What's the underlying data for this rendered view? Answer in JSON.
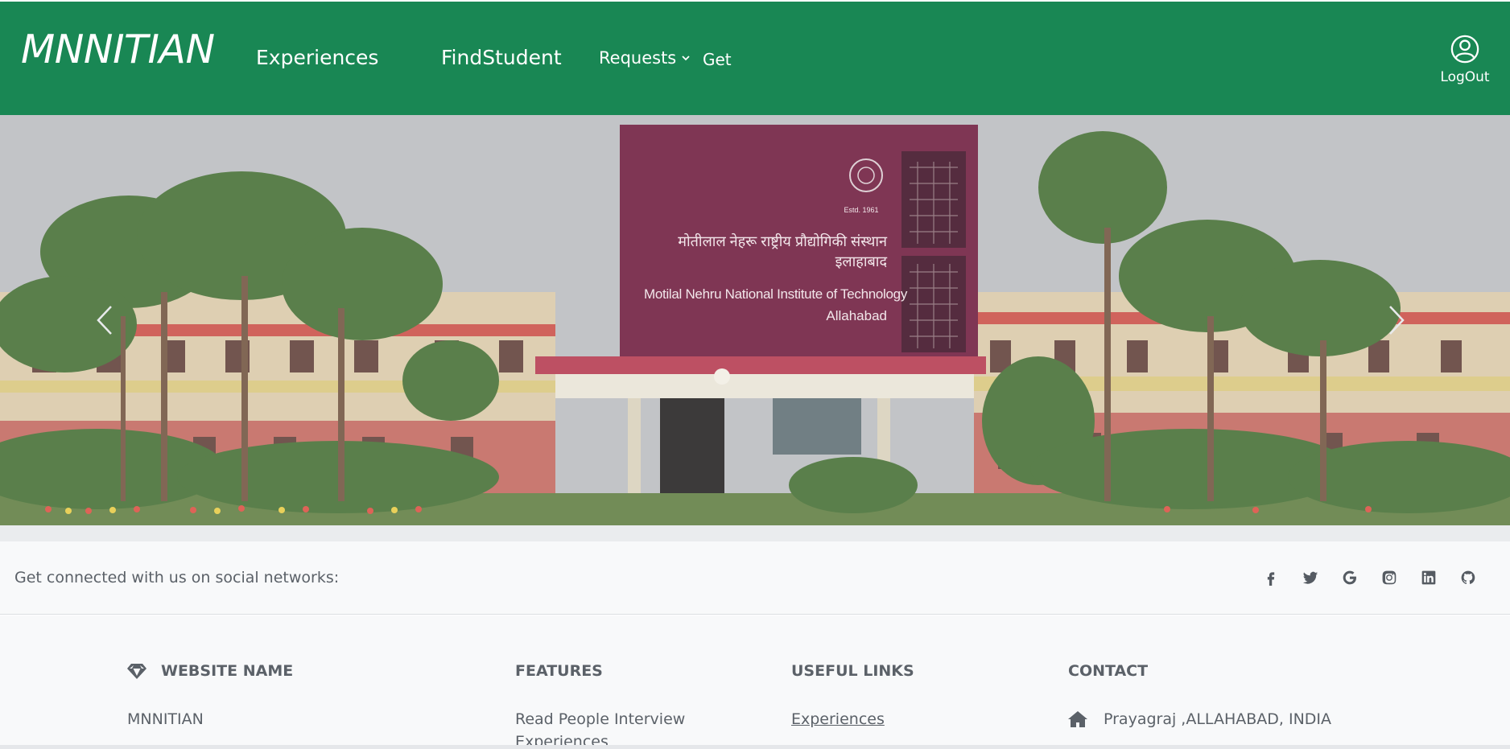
{
  "navbar": {
    "brand": "MNNITIAN",
    "links": {
      "experiences": "Experiences",
      "find_student": "FindStudent",
      "requests": "Requests",
      "get": "Get"
    },
    "logout_label": "LogOut",
    "background_color": "#198754"
  },
  "hero": {
    "building_text": {
      "hindi_line1": "मोतीलाल नेहरू राष्ट्रीय प्रौद्योगिकी संस्थान",
      "hindi_line2": "इलाहाबाद",
      "english_line1": "Motilal Nehru National Institute of Technology",
      "english_line2": "Allahabad",
      "estd": "Estd. 1961"
    },
    "icons": {
      "prev": "chevron-left-icon",
      "next": "chevron-right-icon"
    }
  },
  "social": {
    "text": "Get connected with us on social networks:",
    "icons": [
      "facebook-icon",
      "twitter-icon",
      "google-icon",
      "instagram-icon",
      "linkedin-icon",
      "github-icon"
    ]
  },
  "footer": {
    "website": {
      "title": "WEBSITE NAME",
      "text": "MNNITIAN",
      "icon": "gem-icon"
    },
    "features": {
      "title": "FEATURES",
      "line1": "Read People Interview",
      "line2": "Experiences"
    },
    "useful_links": {
      "title": "USEFUL LINKS",
      "link1": "Experiences"
    },
    "contact": {
      "title": "CONTACT",
      "address": "Prayagraj ,ALLAHABAD, INDIA",
      "icon": "home-icon"
    }
  }
}
